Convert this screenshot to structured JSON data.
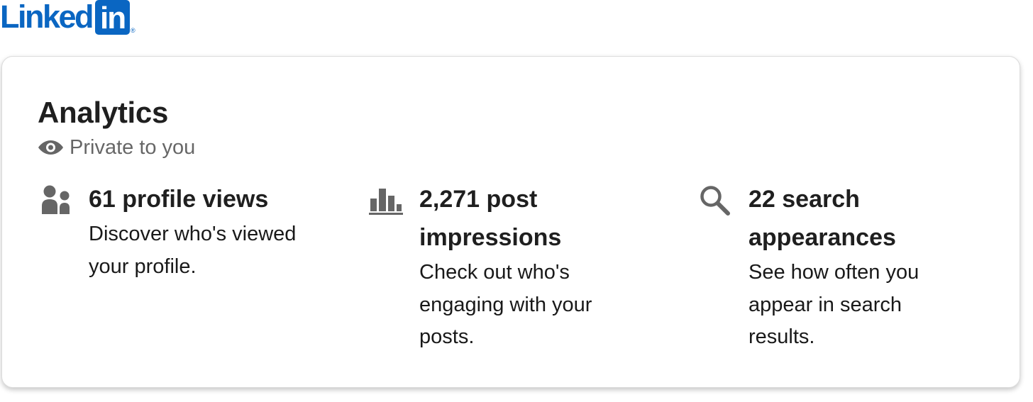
{
  "brand": {
    "name_text": "Linked",
    "box_text": "in",
    "registered": "®",
    "color": "#0a66c2"
  },
  "analytics": {
    "title": "Analytics",
    "privacy_label": "Private to you",
    "privacy_icon": "eye-icon",
    "stats": [
      {
        "icon": "people-icon",
        "title": "61 profile views",
        "description": "Discover who's viewed your profile."
      },
      {
        "icon": "bar-chart-icon",
        "title": "2,271 post impressions",
        "description": "Check out who's engaging with your posts."
      },
      {
        "icon": "search-icon",
        "title": "22 search appearances",
        "description": "See how often you appear in search results."
      }
    ]
  },
  "colors": {
    "icon_gray": "#666666",
    "card_border": "#dcdcdc"
  }
}
